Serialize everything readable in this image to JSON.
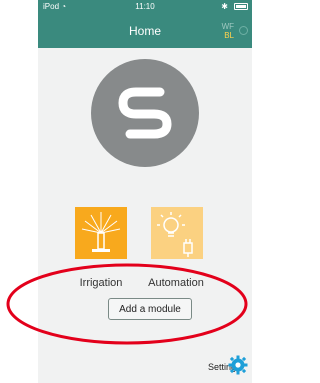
{
  "status_bar": {
    "device": "iPod",
    "time": "11:10"
  },
  "nav": {
    "title": "Home",
    "wf": "WF",
    "bl": "BL"
  },
  "tiles": [
    {
      "label": "Irrigation",
      "color": "#f8a91d",
      "icon": "sprinkler-icon"
    },
    {
      "label": "Automation",
      "color": "#fbd181",
      "icon": "lightbulb-plug-icon"
    }
  ],
  "add_module": {
    "label": "Add a module"
  },
  "settings": {
    "label": "Settings",
    "icon": "gear-icon"
  },
  "colors": {
    "header": "#3a8a7e",
    "annotation": "#e3001b",
    "accent": "#1e9fd8"
  }
}
